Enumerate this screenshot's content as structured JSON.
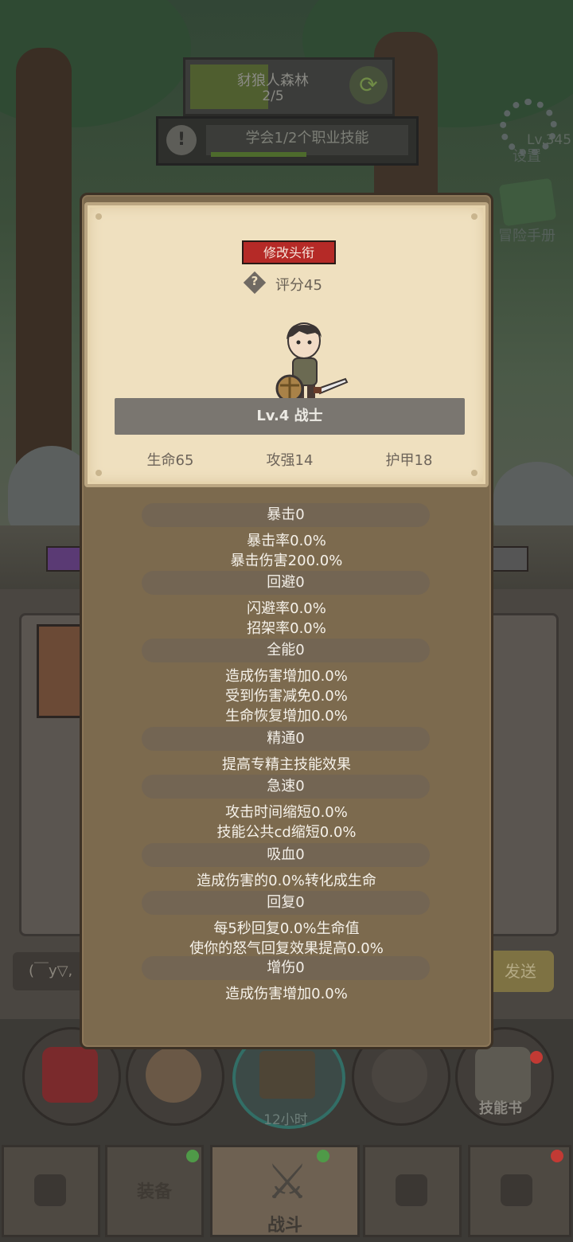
{
  "hud": {
    "zone_name": "豺狼人森林",
    "zone_progress": "2/5",
    "quest_text": "学会1/2个职业技能",
    "quest_icon": "!",
    "right_level": "Lv.345",
    "settings_label": "设置",
    "manual_label": "冒险手册",
    "chat_placeholder": "(￣y▽,",
    "send_label": "发送",
    "center_timer": "12小时",
    "skillbook_label": "技能书"
  },
  "tabs": [
    {
      "label": "",
      "locked": true
    },
    {
      "label": "装备",
      "locked": false
    },
    {
      "label": "战斗",
      "locked": false
    },
    {
      "label": "",
      "locked": true
    },
    {
      "label": "",
      "locked": true
    }
  ],
  "character": {
    "change_title_label": "修改头衔",
    "score_icon_text": "?",
    "score": "评分45",
    "level_class": "Lv.4 战士",
    "hp": "生命65",
    "attack": "攻强14",
    "armor": "护甲18"
  },
  "attributes": [
    {
      "name": "暴击0",
      "lines": [
        "暴击率0.0%",
        "暴击伤害200.0%"
      ]
    },
    {
      "name": "回避0",
      "lines": [
        "闪避率0.0%",
        "招架率0.0%"
      ]
    },
    {
      "name": "全能0",
      "lines": [
        "造成伤害增加0.0%",
        "受到伤害减免0.0%",
        "生命恢复增加0.0%"
      ]
    },
    {
      "name": "精通0",
      "lines": [
        "提高专精主技能效果"
      ]
    },
    {
      "name": "急速0",
      "lines": [
        "攻击时间缩短0.0%",
        "技能公共cd缩短0.0%"
      ]
    },
    {
      "name": "吸血0",
      "lines": [
        "造成伤害的0.0%转化成生命"
      ]
    },
    {
      "name": "回复0",
      "lines": [
        "每5秒回复0.0%生命值",
        "使你的怒气回复效果提高0.0%"
      ]
    },
    {
      "name": "增伤0",
      "lines": [
        "造成伤害增加0.0%"
      ]
    }
  ],
  "colors": {
    "title_button": "#b52a27",
    "panel_brown": "#7c6a4e",
    "parchment": "#efe0bf",
    "badge_green": "#4f9a48",
    "badge_red": "#c23a34"
  }
}
